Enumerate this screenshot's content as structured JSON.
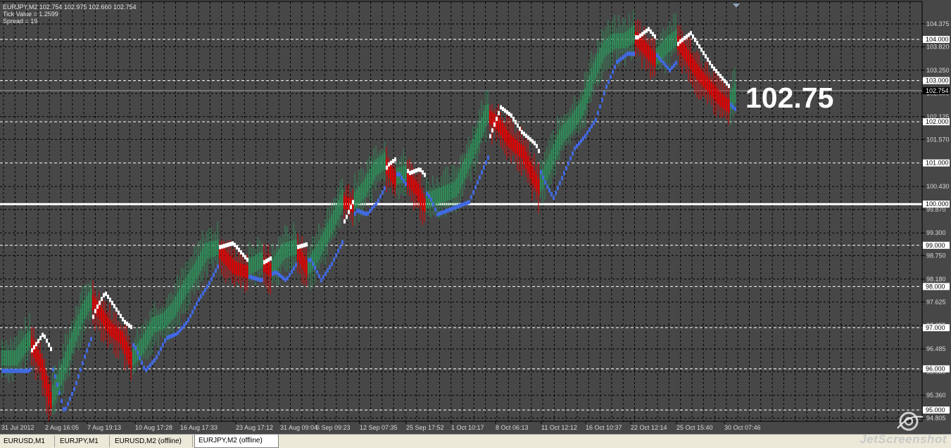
{
  "window": {
    "symbol_line": "EURJPY,M2  102.754 102.975 102.660 102.754",
    "tick_value": "Tick Value = 1.2599",
    "spread": "Spread = 19"
  },
  "big_price": "102.75",
  "price_axis": {
    "labels": [
      {
        "text": "104.375",
        "v": 104.375
      },
      {
        "text": "103.820",
        "v": 103.82
      },
      {
        "text": "103.250",
        "v": 103.25
      },
      {
        "text": "102.690",
        "v": 102.69
      },
      {
        "text": "102.125",
        "v": 102.125
      },
      {
        "text": "101.570",
        "v": 101.57
      },
      {
        "text": "100.430",
        "v": 100.43
      },
      {
        "text": "99.870",
        "v": 99.87
      },
      {
        "text": "99.300",
        "v": 99.3
      },
      {
        "text": "98.750",
        "v": 98.75
      },
      {
        "text": "98.180",
        "v": 98.18
      },
      {
        "text": "97.625",
        "v": 97.625
      },
      {
        "text": "97.055",
        "v": 97.055
      },
      {
        "text": "96.485",
        "v": 96.485
      },
      {
        "text": "95.930",
        "v": 95.93
      },
      {
        "text": "95.360",
        "v": 95.36
      },
      {
        "text": "94.805",
        "v": 94.805
      }
    ],
    "level_boxes": [
      {
        "text": "104.000",
        "v": 104.0
      },
      {
        "text": "103.000",
        "v": 103.0
      },
      {
        "text": "102.000",
        "v": 102.0
      },
      {
        "text": "101.000",
        "v": 101.0
      },
      {
        "text": "100.000",
        "v": 100.0
      },
      {
        "text": "99.000",
        "v": 99.0
      },
      {
        "text": "98.000",
        "v": 98.0
      },
      {
        "text": "97.000",
        "v": 97.0
      },
      {
        "text": "96.000",
        "v": 96.0
      },
      {
        "text": "95.000",
        "v": 95.0
      }
    ],
    "current_price_label": "102.754",
    "current_price": 102.754
  },
  "time_axis": [
    "31 Jul 2012",
    "2 Aug 16:05",
    "7 Aug 19:13",
    "10 Aug 17:28",
    "16 Aug 17:33",
    "23 Aug 17:12",
    "31 Aug 09:04",
    "6 Sep 09:23",
    "12 Sep 07:35",
    "25 Sep 17:52",
    "1 Oct 10:17",
    "8 Oct 06:13",
    "11 Oct 12:12",
    "16 Oct 10:37",
    "22 Oct 12:14",
    "25 Oct 15:40",
    "30 Oct 07:46"
  ],
  "tabs": [
    "EURUSD,M1",
    "EURJPY,M1",
    "EURUSD,M2 (offline)",
    "EURJPY,M2 (offline)"
  ],
  "active_tab": 3,
  "watermark": "JetScreenshot",
  "colors": {
    "background": "#474747",
    "bull": "#2e8b57",
    "bear": "#e00000",
    "ma_up": "#4169e1",
    "ma_down": "#ffffff",
    "grid": "#000000",
    "level_line": "#ffffff",
    "price_line": "#9aa3ad"
  },
  "chart_data": {
    "type": "candlestick",
    "symbol": "EURJPY",
    "timeframe": "M2",
    "ylim": [
      94.805,
      104.6
    ],
    "price_path": [
      [
        0,
        96.2
      ],
      [
        20,
        96.2
      ],
      [
        40,
        96.7
      ],
      [
        55,
        96.2
      ],
      [
        70,
        95.2
      ],
      [
        85,
        95.8
      ],
      [
        100,
        96.6
      ],
      [
        115,
        97.3
      ],
      [
        128,
        97.7
      ],
      [
        140,
        97.4
      ],
      [
        155,
        97.0
      ],
      [
        170,
        96.8
      ],
      [
        185,
        96.2
      ],
      [
        200,
        96.5
      ],
      [
        215,
        97.0
      ],
      [
        230,
        97.1
      ],
      [
        245,
        97.4
      ],
      [
        260,
        97.9
      ],
      [
        275,
        98.3
      ],
      [
        290,
        98.8
      ],
      [
        310,
        98.9
      ],
      [
        330,
        98.5
      ],
      [
        350,
        98.4
      ],
      [
        370,
        98.6
      ],
      [
        385,
        98.4
      ],
      [
        400,
        98.8
      ],
      [
        420,
        98.9
      ],
      [
        435,
        98.4
      ],
      [
        450,
        98.8
      ],
      [
        470,
        99.5
      ],
      [
        485,
        100.1
      ],
      [
        500,
        100.0
      ],
      [
        515,
        100.3
      ],
      [
        530,
        100.8
      ],
      [
        545,
        101.0
      ],
      [
        560,
        100.6
      ],
      [
        575,
        100.7
      ],
      [
        590,
        100.4
      ],
      [
        600,
        100.0
      ],
      [
        615,
        100.1
      ],
      [
        630,
        100.2
      ],
      [
        645,
        100.3
      ],
      [
        660,
        100.9
      ],
      [
        675,
        101.5
      ],
      [
        690,
        102.2
      ],
      [
        705,
        102.0
      ],
      [
        720,
        101.6
      ],
      [
        740,
        101.3
      ],
      [
        755,
        100.7
      ],
      [
        765,
        100.4
      ],
      [
        780,
        101.0
      ],
      [
        795,
        101.6
      ],
      [
        810,
        101.9
      ],
      [
        825,
        102.3
      ],
      [
        840,
        103.1
      ],
      [
        855,
        103.7
      ],
      [
        870,
        103.9
      ],
      [
        885,
        103.9
      ],
      [
        900,
        104.1
      ],
      [
        915,
        103.8
      ],
      [
        930,
        103.5
      ],
      [
        945,
        103.8
      ],
      [
        960,
        104.0
      ],
      [
        975,
        103.6
      ],
      [
        990,
        103.2
      ],
      [
        1005,
        102.9
      ],
      [
        1020,
        102.6
      ],
      [
        1035,
        102.4
      ],
      [
        1045,
        102.75
      ]
    ]
  }
}
